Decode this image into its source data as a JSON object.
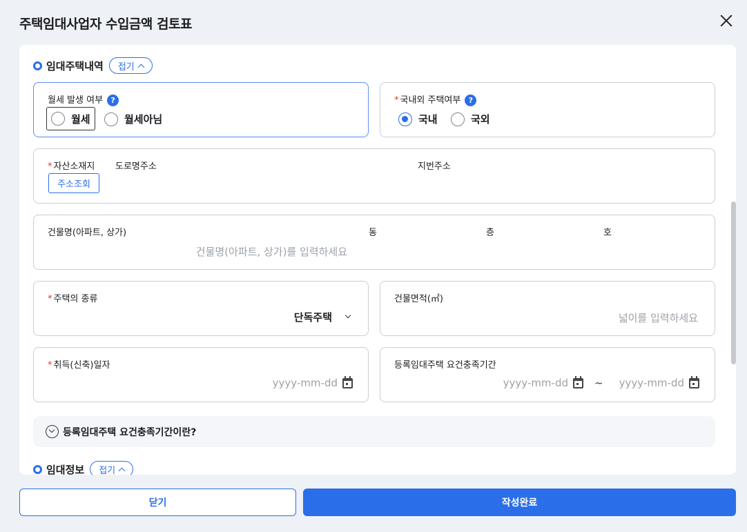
{
  "dialog": {
    "title": "주택임대사업자 수입금액 검토표"
  },
  "section1": {
    "title": "임대주택내역",
    "toggle_label": "접기"
  },
  "section2": {
    "title": "임대정보",
    "toggle_label": "접기"
  },
  "help_glyph": "?",
  "monthly_rent": {
    "label": "월세 발생 여부",
    "options": [
      "월세",
      "월세아님"
    ],
    "selected": null
  },
  "domestic": {
    "label": "국내외 주택여부",
    "options": [
      "국내",
      "국외"
    ],
    "selected": "국내"
  },
  "address": {
    "label": "자산소재지",
    "search_button": "주소조회",
    "road_label": "도로명주소",
    "lot_label": "지번주소"
  },
  "building": {
    "name_label": "건물명(아파트, 상가)",
    "name_placeholder": "건물명(아파트, 상가)를 입력하세요",
    "dong_label": "동",
    "floor_label": "층",
    "ho_label": "호"
  },
  "house_type": {
    "label": "주택의 종류",
    "value": "단독주택"
  },
  "area": {
    "label": "건물면적(㎡)",
    "placeholder": "넓이를 입력하세요"
  },
  "acquire_date": {
    "label": "취득(신축)일자",
    "placeholder": "yyyy-mm-dd"
  },
  "period": {
    "label": "등록임대주택 요건충족기간",
    "start_placeholder": "yyyy-mm-dd",
    "separator": "~",
    "end_placeholder": "yyyy-mm-dd"
  },
  "faq": {
    "label": "등록임대주택 요건충족기간이란?"
  },
  "required_mark": "*",
  "footer": {
    "close_label": "닫기",
    "submit_label": "작성완료"
  },
  "colors": {
    "accent": "#2b6ee9",
    "required": "#e0352b"
  }
}
